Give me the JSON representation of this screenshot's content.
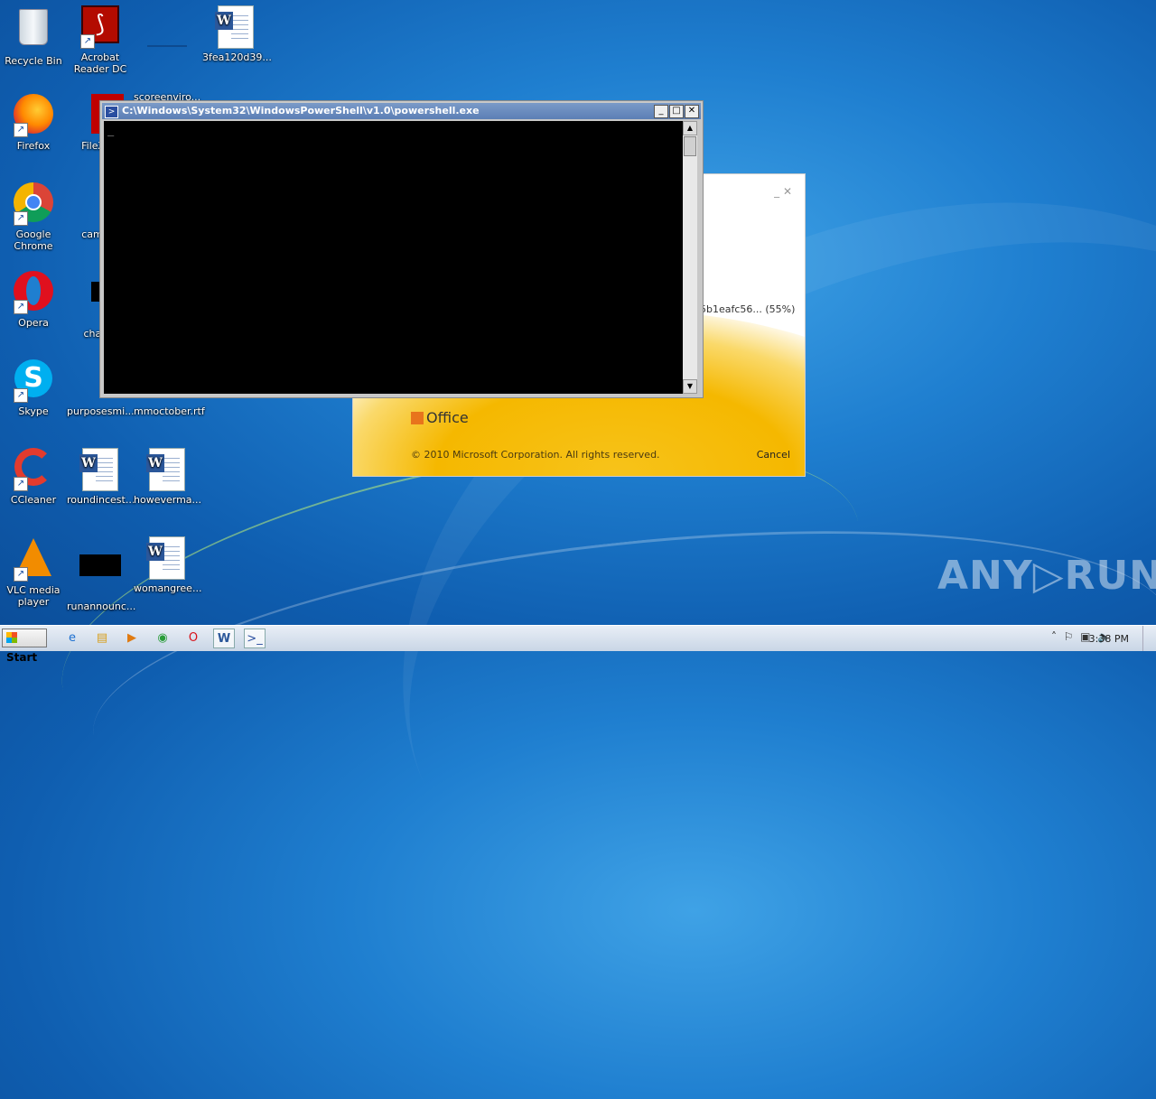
{
  "desktop": {
    "icons": [
      {
        "label": "Recycle Bin"
      },
      {
        "label": "Acrobat Reader DC"
      },
      {
        "label": "scoreenviro..."
      },
      {
        "label": "3fea120d39..."
      },
      {
        "label": "Firefox"
      },
      {
        "label": "FileZilla"
      },
      {
        "label": "Google Chrome"
      },
      {
        "label": "camera"
      },
      {
        "label": "Opera"
      },
      {
        "label": "charac"
      },
      {
        "label": "Skype"
      },
      {
        "label": "purposesmi..."
      },
      {
        "label": "mmoctober.rtf"
      },
      {
        "label": "CCleaner"
      },
      {
        "label": "roundincest..."
      },
      {
        "label": "howeverma..."
      },
      {
        "label": "VLC media player"
      },
      {
        "label": "runannounc..."
      },
      {
        "label": "womangree..."
      }
    ]
  },
  "powershell": {
    "title": "C:\\Windows\\System32\\WindowsPowerShell\\v1.0\\powershell.exe",
    "cursor": "_"
  },
  "office_dialog": {
    "progress_text": "5b1eafc56...  (55%)",
    "logo": "Office",
    "copyright": "© 2010 Microsoft Corporation.  All rights reserved.",
    "cancel_label": "Cancel"
  },
  "taskbar": {
    "start_label": "Start",
    "time": "3:38 PM"
  },
  "watermark": "ANY▷RUN"
}
